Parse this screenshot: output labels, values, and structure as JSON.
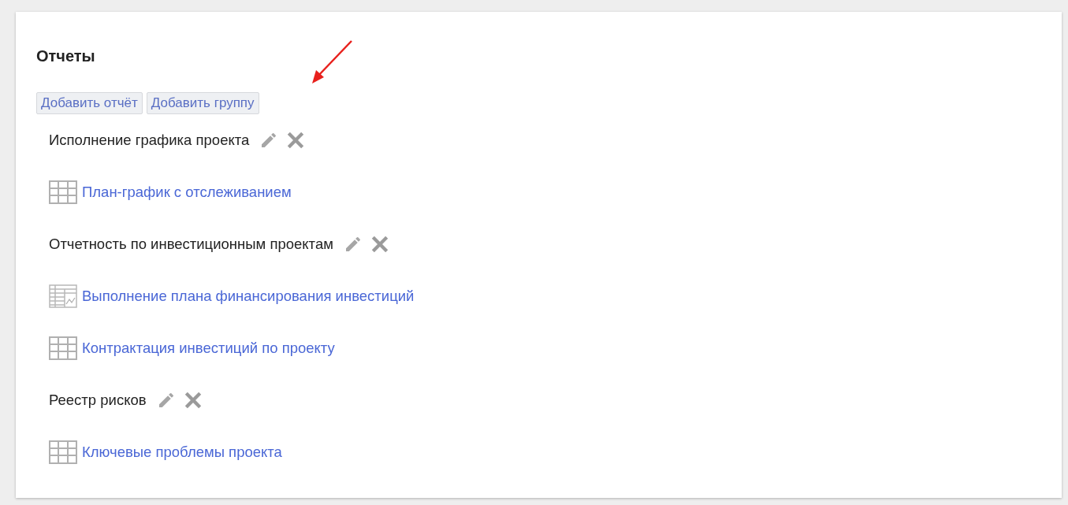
{
  "title": "Отчеты",
  "buttons": [
    "Добавить отчёт",
    "Добавить группу"
  ],
  "groups": [
    {
      "name": "Исполнение графика проекта",
      "reports": [
        {
          "kind": "table",
          "name": "План-график с отслеживанием"
        }
      ]
    },
    {
      "name": "Отчетность по инвестиционным проектам",
      "reports": [
        {
          "kind": "chart-table",
          "name": "Выполнение плана финансирования инвестиций"
        },
        {
          "kind": "table",
          "name": "Контрактация инвестиций по проекту"
        }
      ]
    },
    {
      "name": "Реестр рисков",
      "reports": [
        {
          "kind": "table",
          "name": "Ключевые проблемы проекта"
        }
      ]
    }
  ]
}
